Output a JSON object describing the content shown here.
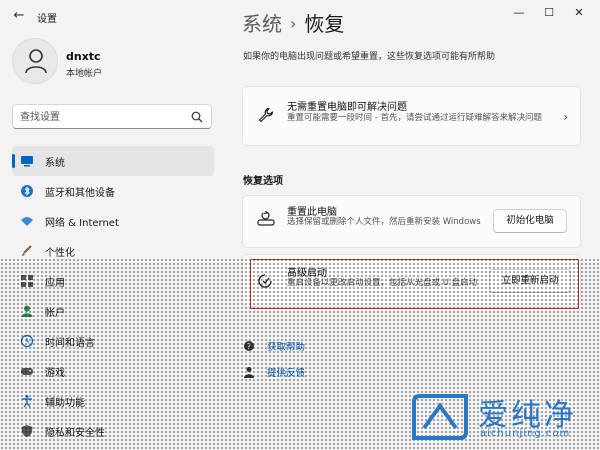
{
  "window": {
    "title": "设置",
    "controls": [
      "minimize-icon",
      "maximize-icon",
      "close-icon"
    ]
  },
  "user": {
    "name": "dnxtc",
    "account_type": "本地帐户"
  },
  "search": {
    "placeholder": "查找设置"
  },
  "sidebar": {
    "items": [
      {
        "label": "系统",
        "icon": "monitor-icon",
        "active": true
      },
      {
        "label": "蓝牙和其他设备",
        "icon": "bluetooth-icon"
      },
      {
        "label": "网络 & Internet",
        "icon": "wifi-icon"
      },
      {
        "label": "个性化",
        "icon": "brush-icon"
      },
      {
        "label": "应用",
        "icon": "apps-icon"
      },
      {
        "label": "帐户",
        "icon": "person-icon"
      },
      {
        "label": "时间和语言",
        "icon": "globe-clock-icon"
      },
      {
        "label": "游戏",
        "icon": "gamepad-icon"
      },
      {
        "label": "辅助功能",
        "icon": "accessibility-icon"
      },
      {
        "label": "隐私和安全性",
        "icon": "shield-icon"
      }
    ]
  },
  "breadcrumb": {
    "parent": "系统",
    "separator": "›",
    "current": "恢复"
  },
  "intro": "如果你的电脑出现问题或希望重置，这些恢复选项可能有所帮助",
  "troubleshoot_card": {
    "icon": "wrench-icon",
    "title": "无需重置电脑即可解决问题",
    "description": "重置可能需要一段时间 - 首先，请尝试通过运行疑难解答来解决问题"
  },
  "recovery_section": {
    "title": "恢复选项",
    "reset": {
      "icon": "reset-pc-icon",
      "title": "重置此电脑",
      "description": "选择保留或删除个人文件，然后重新安装 Windows",
      "button": "初始化电脑"
    },
    "advanced_startup": {
      "icon": "advanced-startup-icon",
      "title": "高级启动",
      "description": "重启设备以更改启动设置，包括从光盘或 U 盘启动",
      "button": "立即重新启动"
    }
  },
  "links": [
    {
      "label": "获取帮助",
      "icon": "help-icon"
    },
    {
      "label": "提供反馈",
      "icon": "feedback-icon"
    }
  ],
  "watermark": {
    "text": "爱纯净",
    "url": "aichunjing.com"
  },
  "colors": {
    "accent": "#0067c0",
    "link": "#005fb8",
    "highlight": "#c0392b",
    "watermark": "#2a78c4"
  }
}
